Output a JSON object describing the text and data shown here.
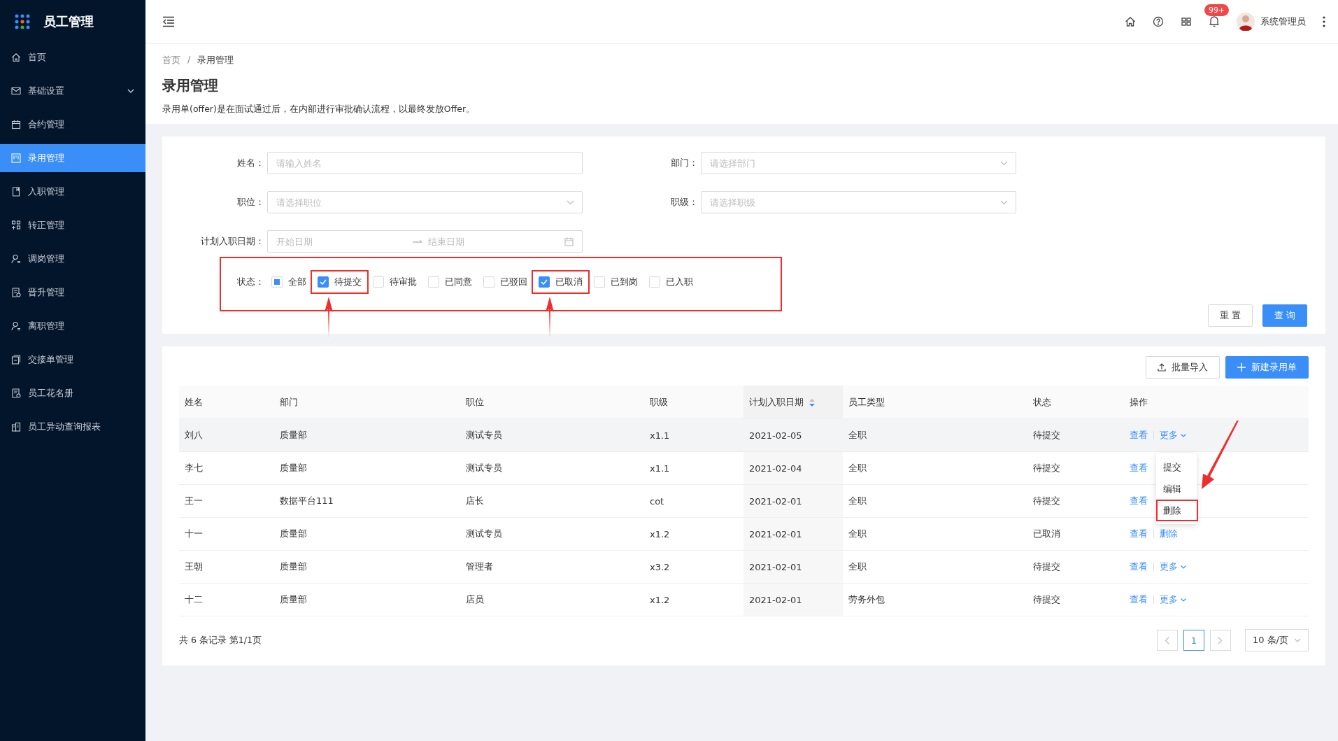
{
  "sidebar": {
    "title": "员工管理",
    "items": [
      {
        "label": "首页",
        "selected": false,
        "expandable": false
      },
      {
        "label": "基础设置",
        "selected": false,
        "expandable": true
      },
      {
        "label": "合约管理",
        "selected": false,
        "expandable": false
      },
      {
        "label": "录用管理",
        "selected": true,
        "expandable": false
      },
      {
        "label": "入职管理",
        "selected": false,
        "expandable": false
      },
      {
        "label": "转正管理",
        "selected": false,
        "expandable": false
      },
      {
        "label": "调岗管理",
        "selected": false,
        "expandable": false
      },
      {
        "label": "晋升管理",
        "selected": false,
        "expandable": false
      },
      {
        "label": "离职管理",
        "selected": false,
        "expandable": false
      },
      {
        "label": "交接单管理",
        "selected": false,
        "expandable": false
      },
      {
        "label": "员工花名册",
        "selected": false,
        "expandable": false
      },
      {
        "label": "员工异动查询报表",
        "selected": false,
        "expandable": false
      }
    ]
  },
  "header": {
    "badge": "99+",
    "user": "系统管理员"
  },
  "breadcrumb": {
    "separator": "/",
    "items": [
      "首页",
      "录用管理"
    ]
  },
  "page_title": "录用管理",
  "description": "录用单(offer)是在面试通过后，在内部进行审批确认流程，以最终发放Offer。",
  "filters": {
    "fields": [
      {
        "label": "姓名：",
        "placeholder": "请输入姓名",
        "kind": "input"
      },
      {
        "label": "部门：",
        "placeholder": "请选择部门",
        "kind": "select"
      },
      {
        "label": "职位：",
        "placeholder": "请选择职位",
        "kind": "select"
      },
      {
        "label": "职级：",
        "placeholder": "请选择职级",
        "kind": "select"
      }
    ],
    "date_range": {
      "label": "计划入职日期：",
      "start_placeholder": "开始日期",
      "end_placeholder": "结束日期"
    },
    "status": {
      "label": "状态：",
      "options": [
        {
          "label": "全部",
          "kind": "all",
          "checked": false,
          "indeterminate": true,
          "highlighted": false
        },
        {
          "label": "待提交",
          "kind": "option",
          "checked": true,
          "highlighted": true
        },
        {
          "label": "待审批",
          "kind": "option",
          "checked": false,
          "highlighted": false
        },
        {
          "label": "已同意",
          "kind": "option",
          "checked": false,
          "highlighted": false
        },
        {
          "label": "已驳回",
          "kind": "option",
          "checked": false,
          "highlighted": false
        },
        {
          "label": "已取消",
          "kind": "option",
          "checked": true,
          "highlighted": true
        },
        {
          "label": "已到岗",
          "kind": "option",
          "checked": false,
          "highlighted": false
        },
        {
          "label": "已入职",
          "kind": "option",
          "checked": false,
          "highlighted": false
        }
      ]
    },
    "buttons": [
      {
        "label": "重 置",
        "kind": "default"
      },
      {
        "label": "查 询",
        "kind": "primary"
      }
    ]
  },
  "toolbar": [
    {
      "label": "批量导入",
      "kind": "default"
    },
    {
      "label": "新建录用单",
      "kind": "primary"
    }
  ],
  "table": {
    "columns": [
      "姓名",
      "部门",
      "职位",
      "职级",
      "计划入职日期",
      "员工类型",
      "状态",
      "操作"
    ],
    "rows": [
      {
        "cells": [
          "刘八",
          "质量部",
          "测试专员",
          "x1.1",
          "2021-02-05",
          "全职",
          "待提交"
        ],
        "hovered": true,
        "actions": [
          {
            "label": "查看",
            "kind": "link"
          },
          {
            "label": "更多",
            "kind": "more"
          }
        ]
      },
      {
        "cells": [
          "李七",
          "质量部",
          "测试专员",
          "x1.1",
          "2021-02-04",
          "全职",
          "待提交"
        ],
        "hovered": false,
        "actions": [
          {
            "label": "查看",
            "kind": "link"
          }
        ]
      },
      {
        "cells": [
          "王一",
          "数据平台111",
          "店长",
          "cot",
          "2021-02-01",
          "全职",
          "待提交"
        ],
        "hovered": false,
        "actions": [
          {
            "label": "查看",
            "kind": "link"
          }
        ]
      },
      {
        "cells": [
          "十一",
          "质量部",
          "测试专员",
          "x1.2",
          "2021-02-01",
          "全职",
          "已取消"
        ],
        "hovered": false,
        "actions": [
          {
            "label": "查看",
            "kind": "link"
          },
          {
            "label": "删除",
            "kind": "link"
          }
        ]
      },
      {
        "cells": [
          "王朝",
          "质量部",
          "管理者",
          "x3.2",
          "2021-02-01",
          "全职",
          "待提交"
        ],
        "hovered": false,
        "actions": [
          {
            "label": "查看",
            "kind": "link"
          },
          {
            "label": "更多",
            "kind": "more"
          }
        ]
      },
      {
        "cells": [
          "十二",
          "质量部",
          "店员",
          "x1.2",
          "2021-02-01",
          "劳务外包",
          "待提交"
        ],
        "hovered": false,
        "actions": [
          {
            "label": "查看",
            "kind": "link"
          },
          {
            "label": "更多",
            "kind": "more"
          }
        ]
      }
    ],
    "menu": [
      {
        "label": "提交",
        "highlighted": false
      },
      {
        "label": "编辑",
        "highlighted": false
      },
      {
        "label": "删除",
        "highlighted": true
      }
    ]
  },
  "pagination": {
    "summary": "共 6 条记录 第1/1页",
    "pages": [
      {
        "label": "1",
        "selected": true
      }
    ],
    "page_size": "10 条/页"
  }
}
